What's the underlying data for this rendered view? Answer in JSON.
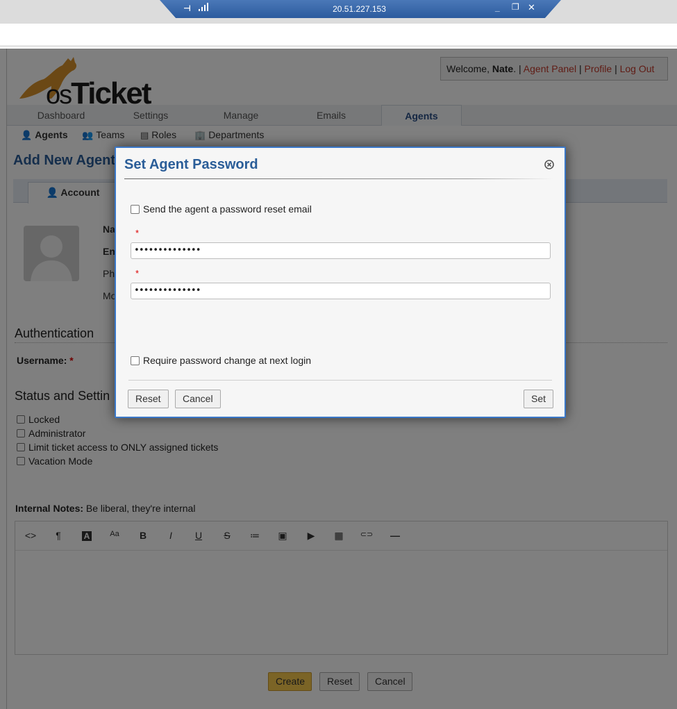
{
  "rdp": {
    "address": "20.51.227.153",
    "pin_icon": "pin-icon",
    "minimize": "_",
    "restore": "❐",
    "close": "✕"
  },
  "header": {
    "logo_text_os": "os",
    "logo_text_ticket": "Ticket",
    "welcome_prefix": "Welcome,",
    "welcome_name": "Nate",
    "welcome_suffix": ".",
    "sep": "|",
    "agent_panel": "Agent Panel",
    "profile": "Profile",
    "logout": "Log Out"
  },
  "nav": {
    "tabs": [
      "Dashboard",
      "Settings",
      "Manage",
      "Emails",
      "Agents"
    ],
    "active": "Agents"
  },
  "subnav": {
    "items": [
      "Agents",
      "Teams",
      "Roles",
      "Departments"
    ],
    "active": "Agents"
  },
  "form": {
    "title": "Add New Agent",
    "tab_account": "Account",
    "labels": [
      "Na",
      "En",
      "Ph",
      "Mo"
    ],
    "auth_heading": "Authentication",
    "username_label": "Username:",
    "required_mark": "*",
    "status_heading": "Status and Settin",
    "flags": [
      "Locked",
      "Administrator",
      "Limit ticket access to ONLY assigned tickets",
      "Vacation Mode"
    ],
    "notes_label": "Internal Notes:",
    "notes_hint": "Be liberal, they're internal",
    "toolbar": [
      "<>",
      "¶",
      "A",
      "Aa",
      "B",
      "I",
      "U",
      "S",
      "≔",
      "▣",
      "▶",
      "▦",
      "⊂⊃",
      "—"
    ],
    "buttons": {
      "create": "Create",
      "reset": "Reset",
      "cancel": "Cancel"
    }
  },
  "modal": {
    "title": "Set Agent Password",
    "send_reset_label": "Send the agent a password reset email",
    "required_mark": "*",
    "password1": "••••••••••••••",
    "password2": "••••••••••••••",
    "require_change_label": "Require password change at next login",
    "buttons": {
      "reset": "Reset",
      "cancel": "Cancel",
      "set": "Set"
    }
  },
  "colors": {
    "accent": "#2a5d98",
    "link": "#c0392b",
    "modal_border": "#3a78c9",
    "create_button": "#f6c84c"
  }
}
